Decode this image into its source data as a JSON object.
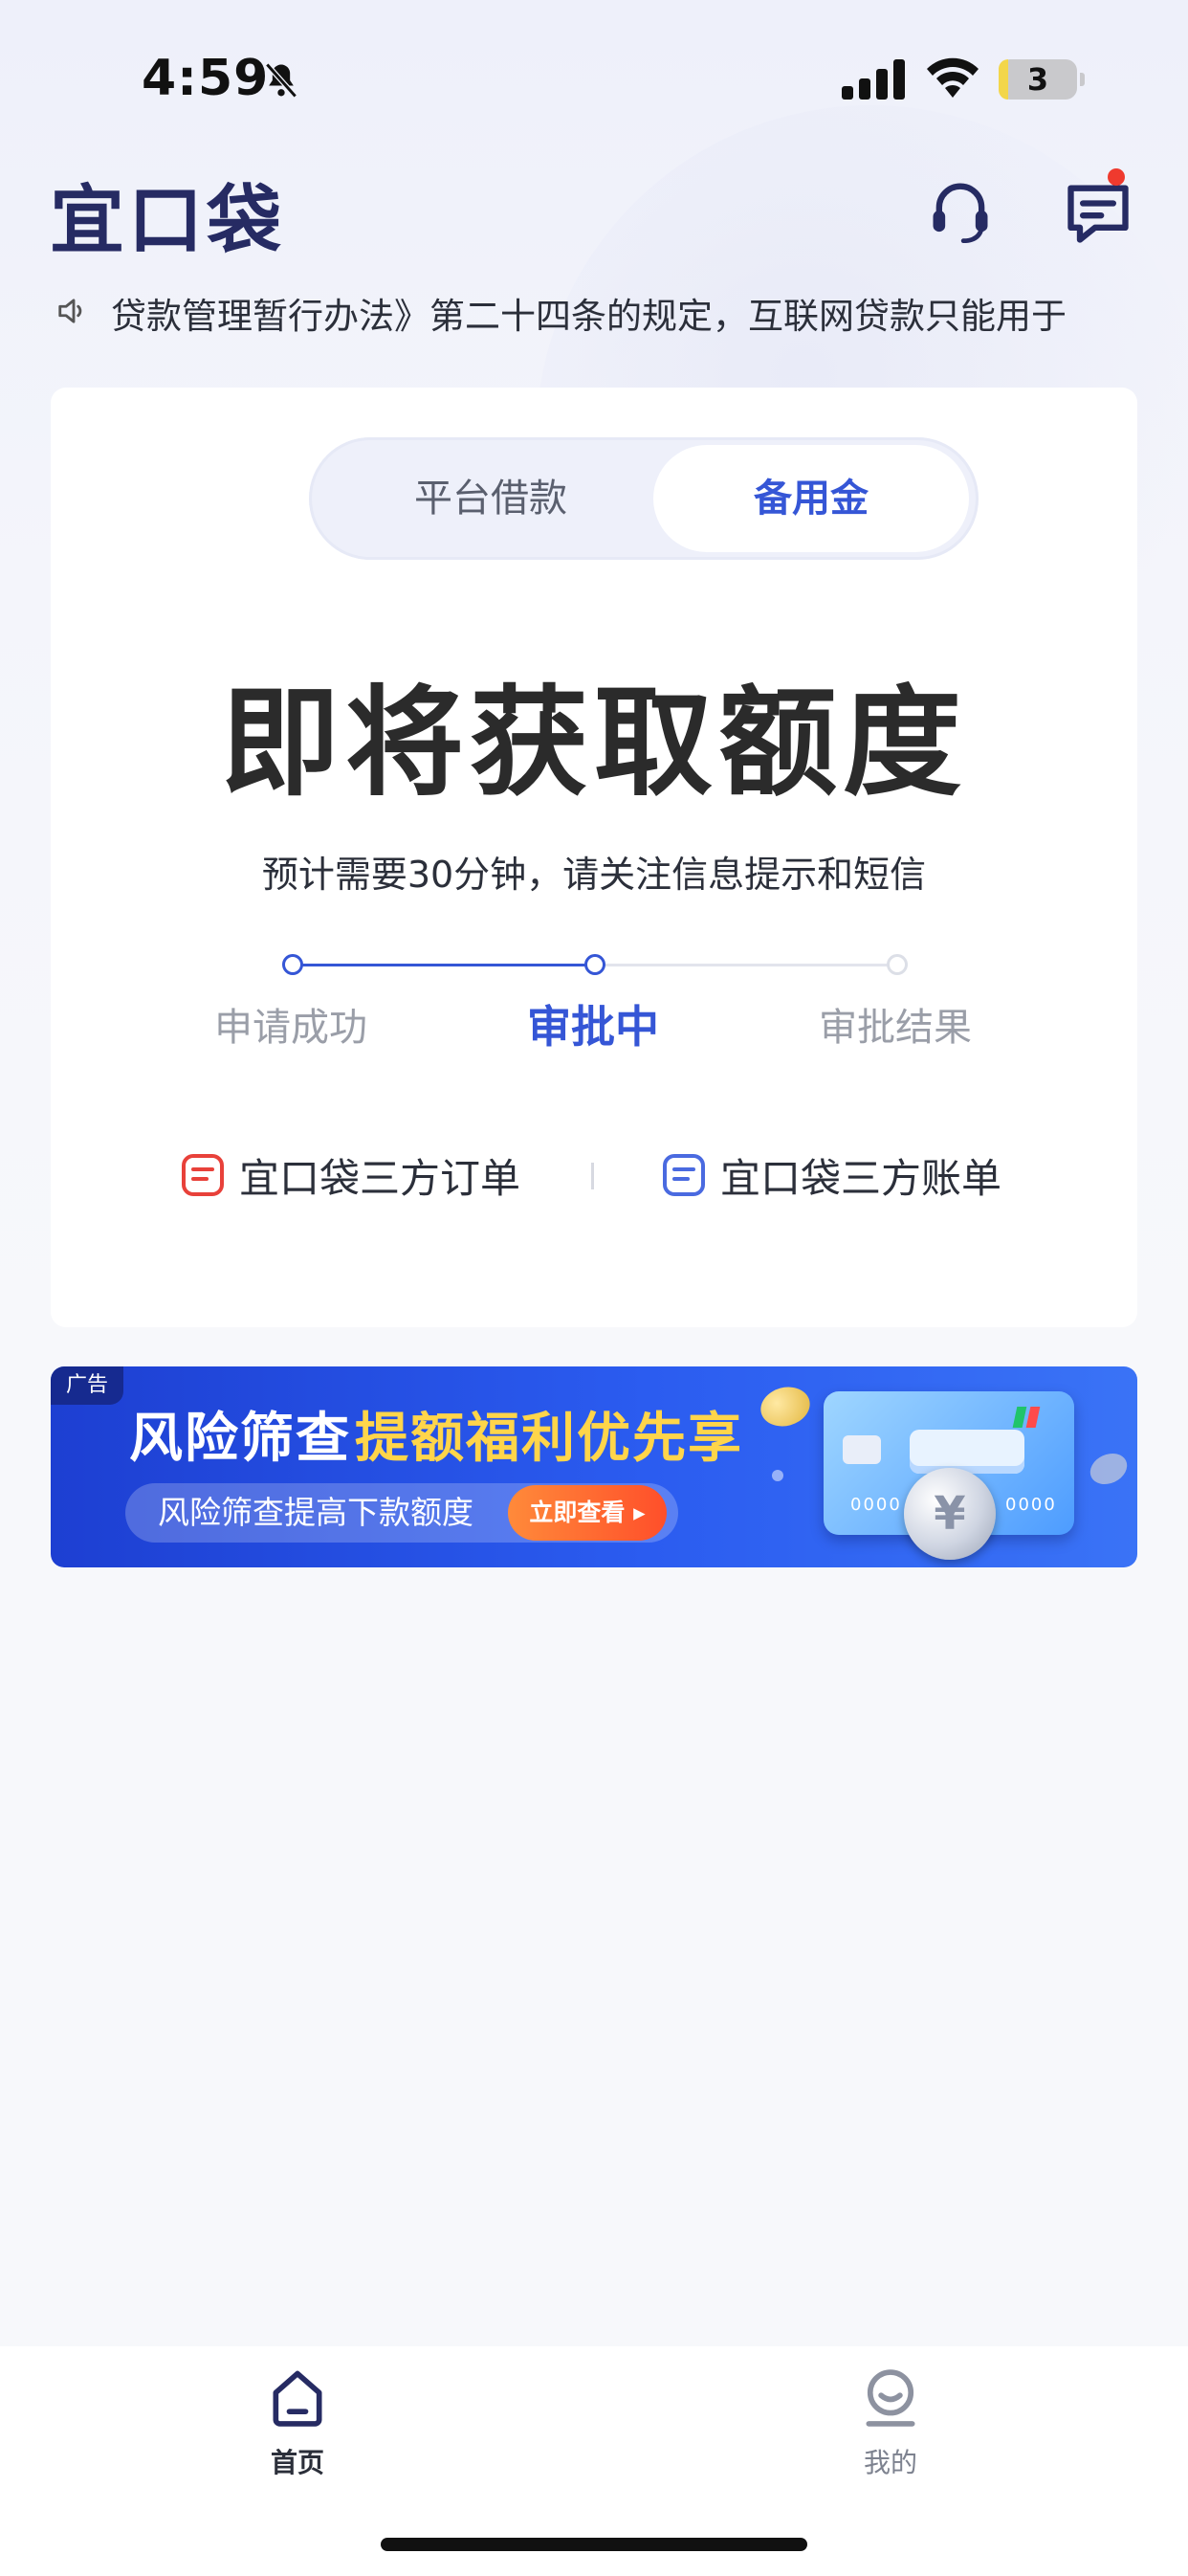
{
  "status_bar": {
    "time": "4:59",
    "battery_level": "3",
    "icons": [
      "bell-slash-icon",
      "signal-icon",
      "wifi-icon",
      "battery-icon"
    ]
  },
  "header": {
    "logo_text": "宜口袋",
    "icons": [
      "headset-icon",
      "message-icon"
    ]
  },
  "notice": {
    "text": "贷款管理暂行办法》第二十四条的规定，互联网贷款只能用于",
    "icon": "speaker-icon"
  },
  "toggle": {
    "left": "平台借款",
    "right": "备用金",
    "selected": "备用金"
  },
  "main": {
    "title": "即将获取额度",
    "subtitle": "预计需要30分钟，请关注信息提示和短信"
  },
  "progress": {
    "steps": [
      "申请成功",
      "审批中",
      "审批结果"
    ],
    "current_index": 1
  },
  "links": {
    "orders": "宜口袋三方订单",
    "bills": "宜口袋三方账单"
  },
  "banner": {
    "tag": "广告",
    "title_white": "风险筛查",
    "title_yellow": "提额福利优先享",
    "pill_text": "风险筛查提高下款额度",
    "cta": "立即查看 ▸",
    "card_digits_left": "0000",
    "card_digits_right": "0000",
    "coin_symbol": "¥"
  },
  "tabbar": {
    "home": "首页",
    "mine": "我的"
  },
  "colors": {
    "accent": "#3556d6",
    "logo": "#262b63",
    "banner": "#2b5cf0",
    "cta": "#ff5a2c",
    "highlight": "#ffd54a"
  }
}
